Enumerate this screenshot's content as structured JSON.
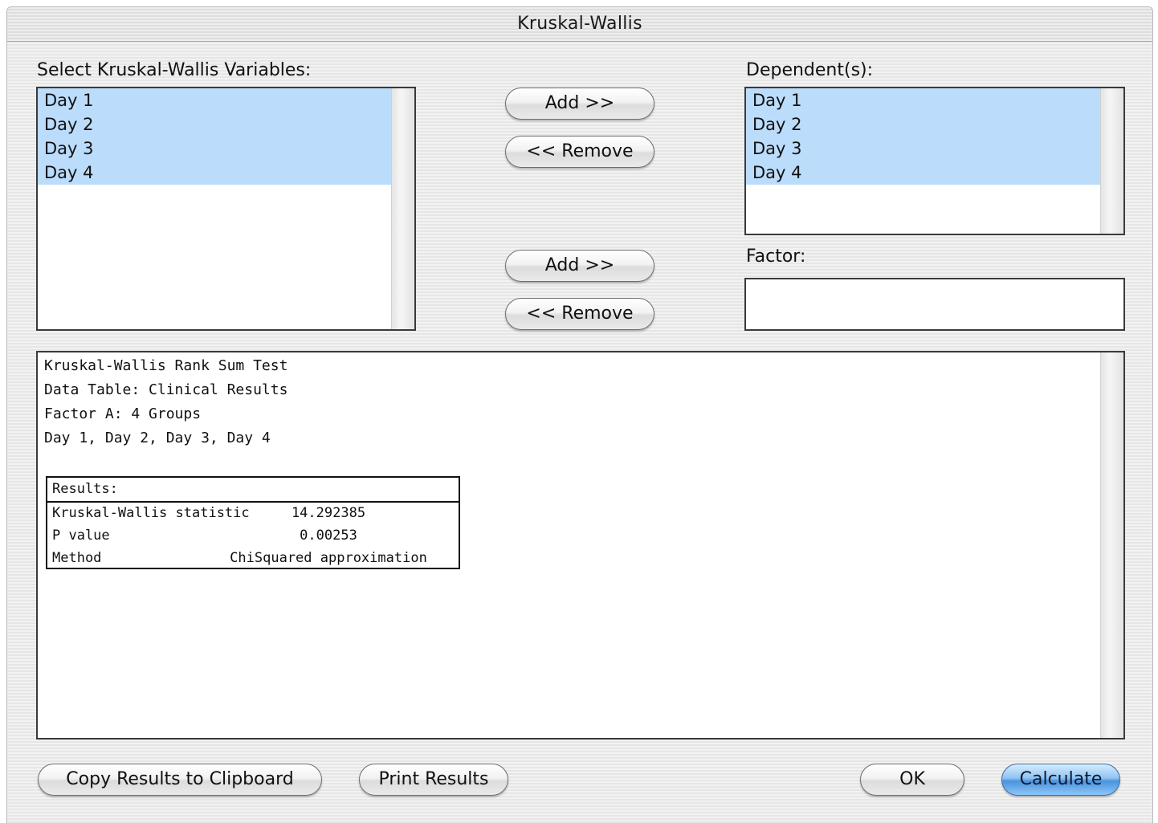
{
  "window": {
    "title": "Kruskal-Wallis"
  },
  "variables": {
    "label": "Select Kruskal-Wallis Variables:",
    "items": [
      "Day 1",
      "Day 2",
      "Day 3",
      "Day 4"
    ]
  },
  "dependents": {
    "label": "Dependent(s):",
    "items": [
      "Day 1",
      "Day 2",
      "Day 3",
      "Day 4"
    ]
  },
  "factor": {
    "label": "Factor:"
  },
  "buttons": {
    "add_dependent": "Add >>",
    "remove_dependent": "<< Remove",
    "add_factor": "Add >>",
    "remove_factor": "<< Remove",
    "copy_results": "Copy Results to Clipboard",
    "print_results": "Print Results",
    "ok": "OK",
    "calculate": "Calculate"
  },
  "results": {
    "lines": [
      "Kruskal-Wallis Rank Sum Test",
      "Data Table: Clinical Results",
      "Factor A: 4 Groups",
      "Day 1,  Day 2,  Day 3,  Day 4"
    ],
    "table": {
      "header": "Results:",
      "rows": [
        {
          "label": "Kruskal-Wallis statistic",
          "value": "14.292385"
        },
        {
          "label": "P value",
          "value": "0.00253"
        },
        {
          "label": "Method",
          "value": "ChiSquared approximation"
        }
      ]
    }
  }
}
